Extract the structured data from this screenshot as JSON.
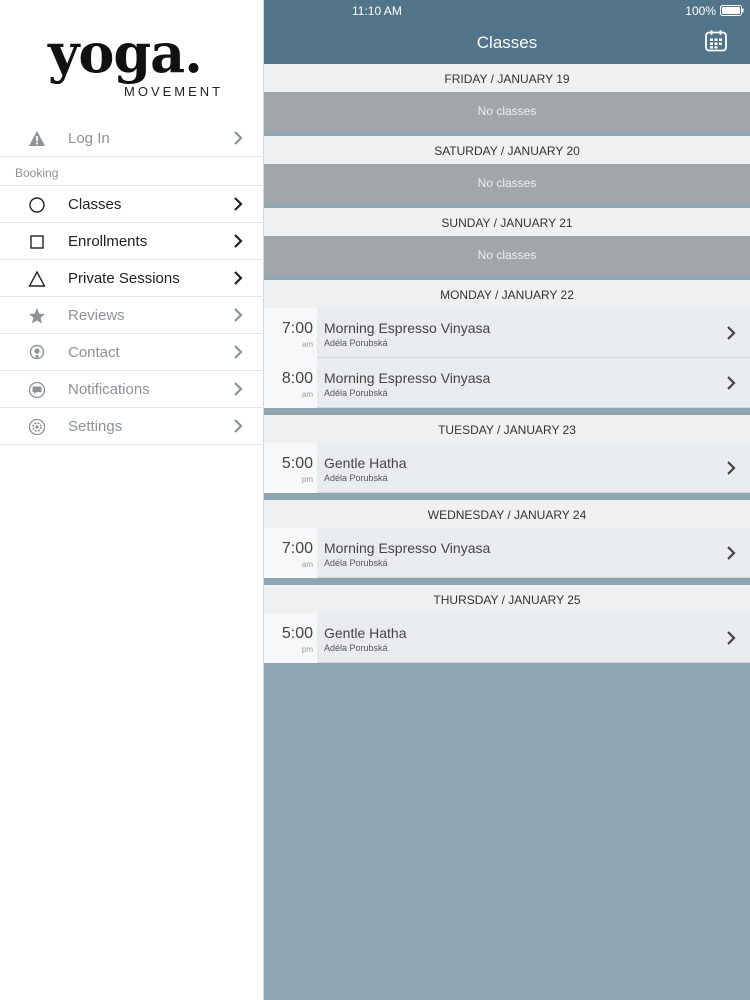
{
  "brand": {
    "name": "yoga.",
    "subtitle": "MOVEMENT"
  },
  "sidebar": {
    "top_items": [
      {
        "label": "Log In",
        "icon": "warning-icon"
      }
    ],
    "section_label": "Booking",
    "items": [
      {
        "label": "Classes",
        "icon": "circle-icon",
        "state": "active"
      },
      {
        "label": "Enrollments",
        "icon": "square-icon",
        "state": "active"
      },
      {
        "label": "Private Sessions",
        "icon": "triangle-icon",
        "state": "active"
      },
      {
        "label": "Reviews",
        "icon": "star-icon",
        "state": "muted"
      },
      {
        "label": "Contact",
        "icon": "location-pin-icon",
        "state": "muted"
      },
      {
        "label": "Notifications",
        "icon": "chat-bubble-icon",
        "state": "muted"
      },
      {
        "label": "Settings",
        "icon": "gear-icon",
        "state": "muted"
      }
    ]
  },
  "status_bar": {
    "time": "11:10 AM",
    "battery": "100%"
  },
  "nav": {
    "title": "Classes",
    "right_icon": "calendar-icon"
  },
  "schedule": {
    "no_classes_text": "No classes",
    "days": [
      {
        "header": "FRIDAY / JANUARY 19",
        "classes": []
      },
      {
        "header": "SATURDAY / JANUARY 20",
        "classes": []
      },
      {
        "header": "SUNDAY / JANUARY 21",
        "classes": []
      },
      {
        "header": "MONDAY / JANUARY 22",
        "classes": [
          {
            "time": "7:00",
            "ampm": "am",
            "name": "Morning Espresso Vinyasa",
            "teacher": "Adéla Porubská"
          },
          {
            "time": "8:00",
            "ampm": "am",
            "name": "Morning Espresso Vinyasa",
            "teacher": "Adéla Porubská"
          }
        ]
      },
      {
        "header": "TUESDAY / JANUARY 23",
        "classes": [
          {
            "time": "5:00",
            "ampm": "pm",
            "name": "Gentle Hatha",
            "teacher": "Adéla Porubská"
          }
        ]
      },
      {
        "header": "WEDNESDAY / JANUARY 24",
        "classes": [
          {
            "time": "7:00",
            "ampm": "am",
            "name": "Morning Espresso Vinyasa",
            "teacher": "Adéla Porubská"
          }
        ]
      },
      {
        "header": "THURSDAY / JANUARY 25",
        "classes": [
          {
            "time": "5:00",
            "ampm": "pm",
            "name": "Gentle Hatha",
            "teacher": "Adéla Porubská"
          }
        ]
      }
    ]
  },
  "colors": {
    "nav_bg": "#527488",
    "pane_bg": "#8ea5b2",
    "no_classes_bg": "#a0a6aa",
    "day_header_bg": "#eef0f2",
    "active_text": "#222222",
    "muted_text": "#8c9296"
  }
}
